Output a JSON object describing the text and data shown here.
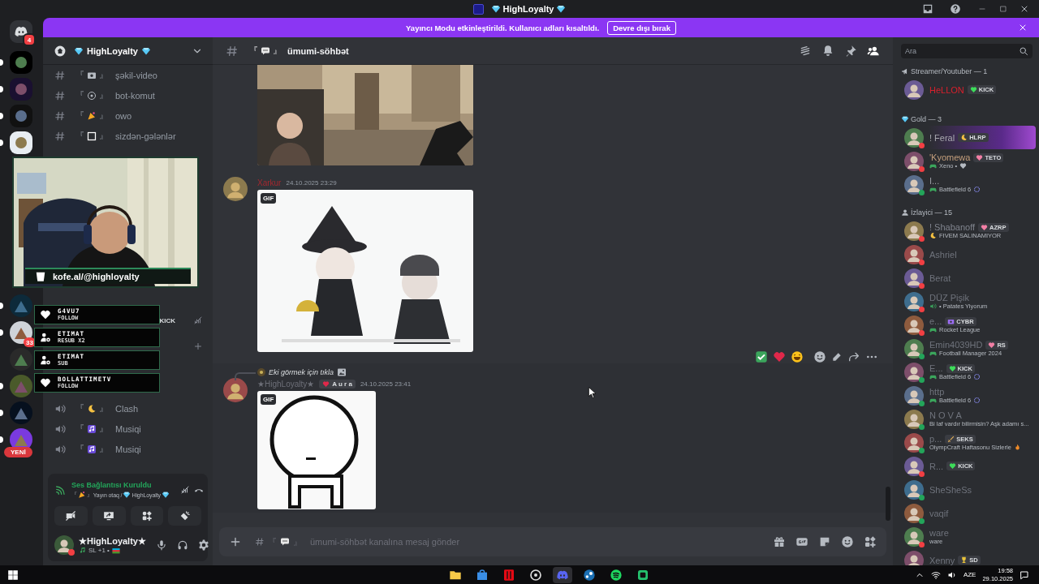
{
  "title_bar": {
    "title": "HighLoyalty"
  },
  "home": {
    "badge": "4"
  },
  "servers_top": [
    {
      "unread": true
    },
    {
      "unread": true
    },
    {
      "unread": true
    },
    {
      "unread": true
    }
  ],
  "servers_bottom": [
    {
      "unread": true
    },
    {
      "unread": true,
      "badge": "33"
    },
    {
      "unread": false
    },
    {
      "unread": true
    },
    {
      "unread": true
    },
    {
      "unread": true
    }
  ],
  "new_label": "YENİ",
  "banner": {
    "text": "Yayıncı Modu etkinleştirildi. Kullanıcı adları kısaltıldı.",
    "button": "Devre dışı bırak"
  },
  "server": {
    "name": "HighLoyalty"
  },
  "text_channels": [
    {
      "open": "『",
      "kind": "camera",
      "close": "』",
      "name": "şəkil-video"
    },
    {
      "open": "『",
      "kind": "bot",
      "close": "』",
      "name": "bot-komut"
    },
    {
      "open": "『",
      "kind": "cone",
      "close": "』",
      "name": "owo"
    },
    {
      "open": "『",
      "kind": "square",
      "close": "』",
      "name": "sizdən-gələnlər"
    }
  ],
  "hidden_row_tag": "KICK",
  "voice_channels": [
    {
      "open": "『",
      "kind": "moon",
      "close": "』",
      "name": "Clash"
    },
    {
      "open": "『",
      "kind": "music",
      "close": "』",
      "name": "Musiqi"
    },
    {
      "open": "『",
      "kind": "music",
      "close": "』",
      "name": "Musiqi"
    }
  ],
  "voice_status": {
    "title": "Ses Bağlantısı Kuruldu",
    "open": "『",
    "close": "』",
    "room": "Yayın otaq /",
    "server": "HighLoyalty"
  },
  "user": {
    "name": "★HighLoyalty★",
    "online": false,
    "activity": "SL +1 •"
  },
  "channel_header": {
    "open": "『",
    "close": "』",
    "name": "ümumi-söhbət"
  },
  "messages": [
    {
      "kind": "picture"
    },
    {
      "kind": "gif",
      "author": "Xarkur",
      "color": "#a3282f",
      "time": "24.10.2025 23:29",
      "gif_label": "GIF",
      "hovered": false
    },
    {
      "kind": "reply",
      "reply": "Eki görmek için tıkla",
      "author": "★HighLoyalty★",
      "color": "#6d6f78",
      "badge": "A u r a",
      "time": "24.10.2025 23:41",
      "gif_label": "GIF",
      "hovered": true
    }
  ],
  "composer": {
    "open": "『",
    "close": "』",
    "placeholder": "ümumi-söhbət kanalına mesaj gönder"
  },
  "members": {
    "search_placeholder": "Ara",
    "groups": [
      {
        "kind": "streamer",
        "title": "Streamer/Youtuber — 1",
        "members": [
          {
            "name": "HeLLON",
            "color": "#d9202c",
            "tag": {
              "kind": "heart",
              "color": "#3ddc5a",
              "text": "KICK"
            }
          }
        ]
      },
      {
        "kind": "gold",
        "title": "Gold — 3",
        "members": [
          {
            "name": "! Feral",
            "color": "#a9a9b0",
            "online": false,
            "nameplate": true,
            "tag": {
              "kind": "moon",
              "text": "HLRP"
            }
          },
          {
            "name": "'Kyomewa",
            "color": "#c49f7c",
            "online": false,
            "tag": {
              "kind": "heart",
              "color": "#f27fa5",
              "text": "TETO"
            },
            "activity": {
              "kind": "gameheart",
              "text": "Xeno •"
            }
          },
          {
            "name": "I...",
            "color": "#9a9ca3",
            "online": true,
            "activity": {
              "kind": "gamering",
              "text": "Battlefield 6"
            }
          }
        ]
      },
      {
        "kind": "viewer",
        "title": "İzlayici — 15",
        "members": [
          {
            "name": "! Shabanoff",
            "color": "#80848e",
            "online": false,
            "tag": {
              "kind": "heart",
              "color": "#f27fa5",
              "text": "AZRP"
            },
            "activity": {
              "kind": "moon",
              "text": "FIVEM SALINAMIYOR"
            }
          },
          {
            "name": "Ashriel",
            "color": "#6f737c",
            "online": false
          },
          {
            "name": "Berat",
            "color": "#6f737c",
            "online": false
          },
          {
            "name": "DÜZ Pişik",
            "color": "#6f737c",
            "online": false,
            "activity": {
              "kind": "speaker",
              "text": "• Patates Yiyorum"
            }
          },
          {
            "name": "e...",
            "color": "#6f737c",
            "online": false,
            "tag": {
              "kind": "camera",
              "text": "CYBR"
            },
            "activity": {
              "kind": "game",
              "text": "Rocket League"
            }
          },
          {
            "name": "Emin4039HD",
            "color": "#6f737c",
            "online": true,
            "tag": {
              "kind": "heart",
              "color": "#f27fa5",
              "text": "RS"
            },
            "activity": {
              "kind": "game",
              "text": "Football Manager 2024"
            }
          },
          {
            "name": "E...",
            "color": "#6f737c",
            "online": true,
            "tag": {
              "kind": "heart",
              "color": "#3ddc5a",
              "text": "KICK"
            },
            "activity": {
              "kind": "gamering",
              "text": "Battlefield 6"
            }
          },
          {
            "name": "http",
            "color": "#6f737c",
            "online": true,
            "activity": {
              "kind": "gamering",
              "text": "Battlefield 6"
            }
          },
          {
            "name": "N O V A",
            "color": "#6f737c",
            "online": true,
            "activity": {
              "kind": "plain",
              "text": "Bi laf vardır bilirmisin? Aşk adamı s..."
            }
          },
          {
            "name": "p...",
            "color": "#6f737c",
            "online": true,
            "tag": {
              "kind": "sword",
              "text": "SEKS"
            },
            "activity": {
              "kind": "fire",
              "text": "OlympCraft Haftasonu Sizlerle"
            }
          },
          {
            "name": "R...",
            "color": "#6f737c",
            "online": false,
            "tag": {
              "kind": "heart",
              "color": "#3ddc5a",
              "text": "KICK"
            }
          },
          {
            "name": "SheSheSs",
            "color": "#6f737c",
            "online": true
          },
          {
            "name": "vaqif",
            "color": "#6f737c",
            "online": true
          },
          {
            "name": "ware",
            "color": "#6f737c",
            "online": false,
            "activity": {
              "kind": "plain",
              "text": "ware"
            }
          },
          {
            "name": "Xenny",
            "color": "#6f737c",
            "tag": {
              "kind": "trophy",
              "text": "SD"
            }
          }
        ]
      }
    ]
  },
  "stream_overlay": {
    "link": "kofe.al/@highloyalty",
    "alerts": [
      {
        "kind": "follow",
        "name": "G4VU7",
        "event": "FOLLOW"
      },
      {
        "kind": "sub",
        "name": "ETIMAT",
        "event": "RESUB X2"
      },
      {
        "kind": "sub",
        "name": "ETIMAT",
        "event": "SUB"
      },
      {
        "kind": "follow",
        "name": "BOLLATTIMETV",
        "event": "FOLLOW"
      }
    ]
  },
  "taskbar": {
    "language": "AZE",
    "time": "19:58",
    "date": "29.10.2025"
  }
}
